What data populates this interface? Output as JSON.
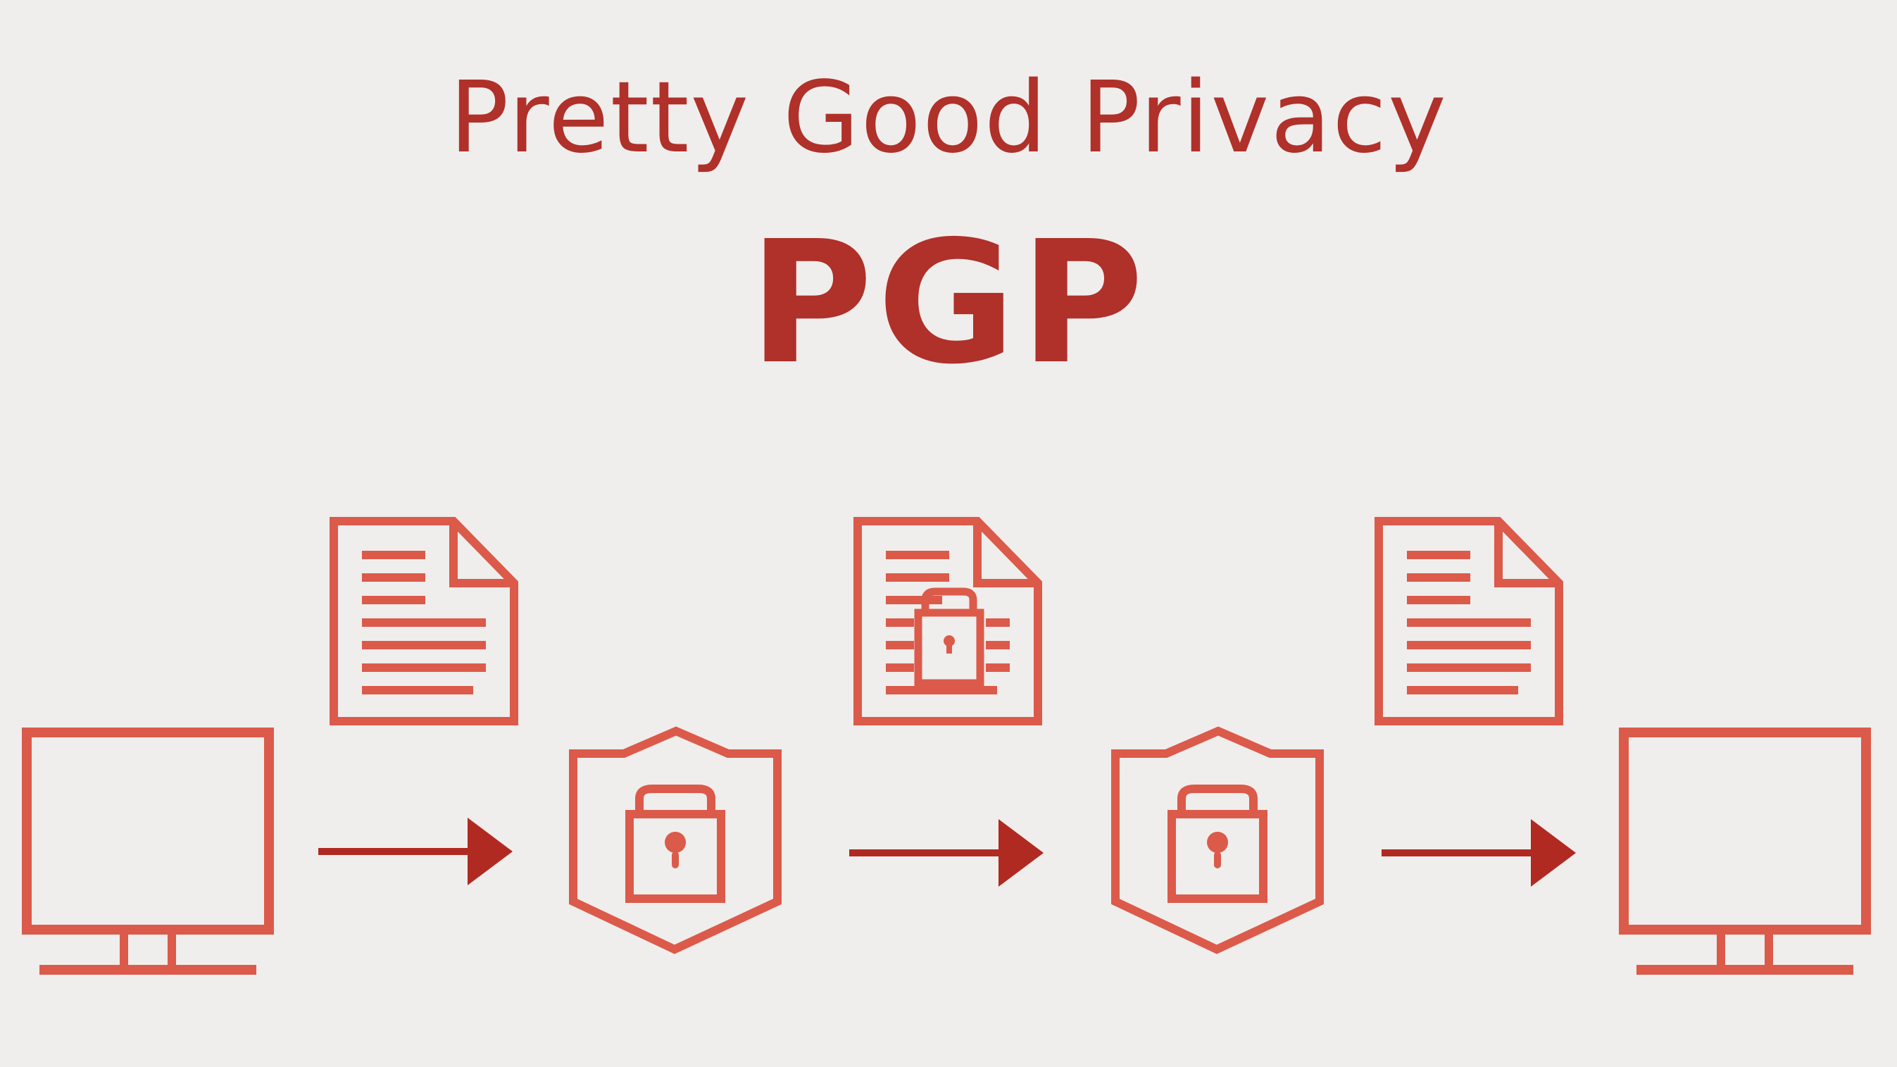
{
  "title": "Pretty Good Privacy",
  "acronym": "PGP",
  "colors": {
    "background": "#efeeec",
    "text": "#b0302a",
    "icon_stroke": "#dc5a4a",
    "arrow": "#b02a22"
  },
  "flow": [
    "computer-icon",
    "arrow-icon",
    "shield-lock-icon",
    "arrow-icon",
    "shield-lock-icon",
    "arrow-icon",
    "computer-icon"
  ],
  "documents": [
    "document-icon",
    "encrypted-document-icon",
    "document-icon"
  ]
}
